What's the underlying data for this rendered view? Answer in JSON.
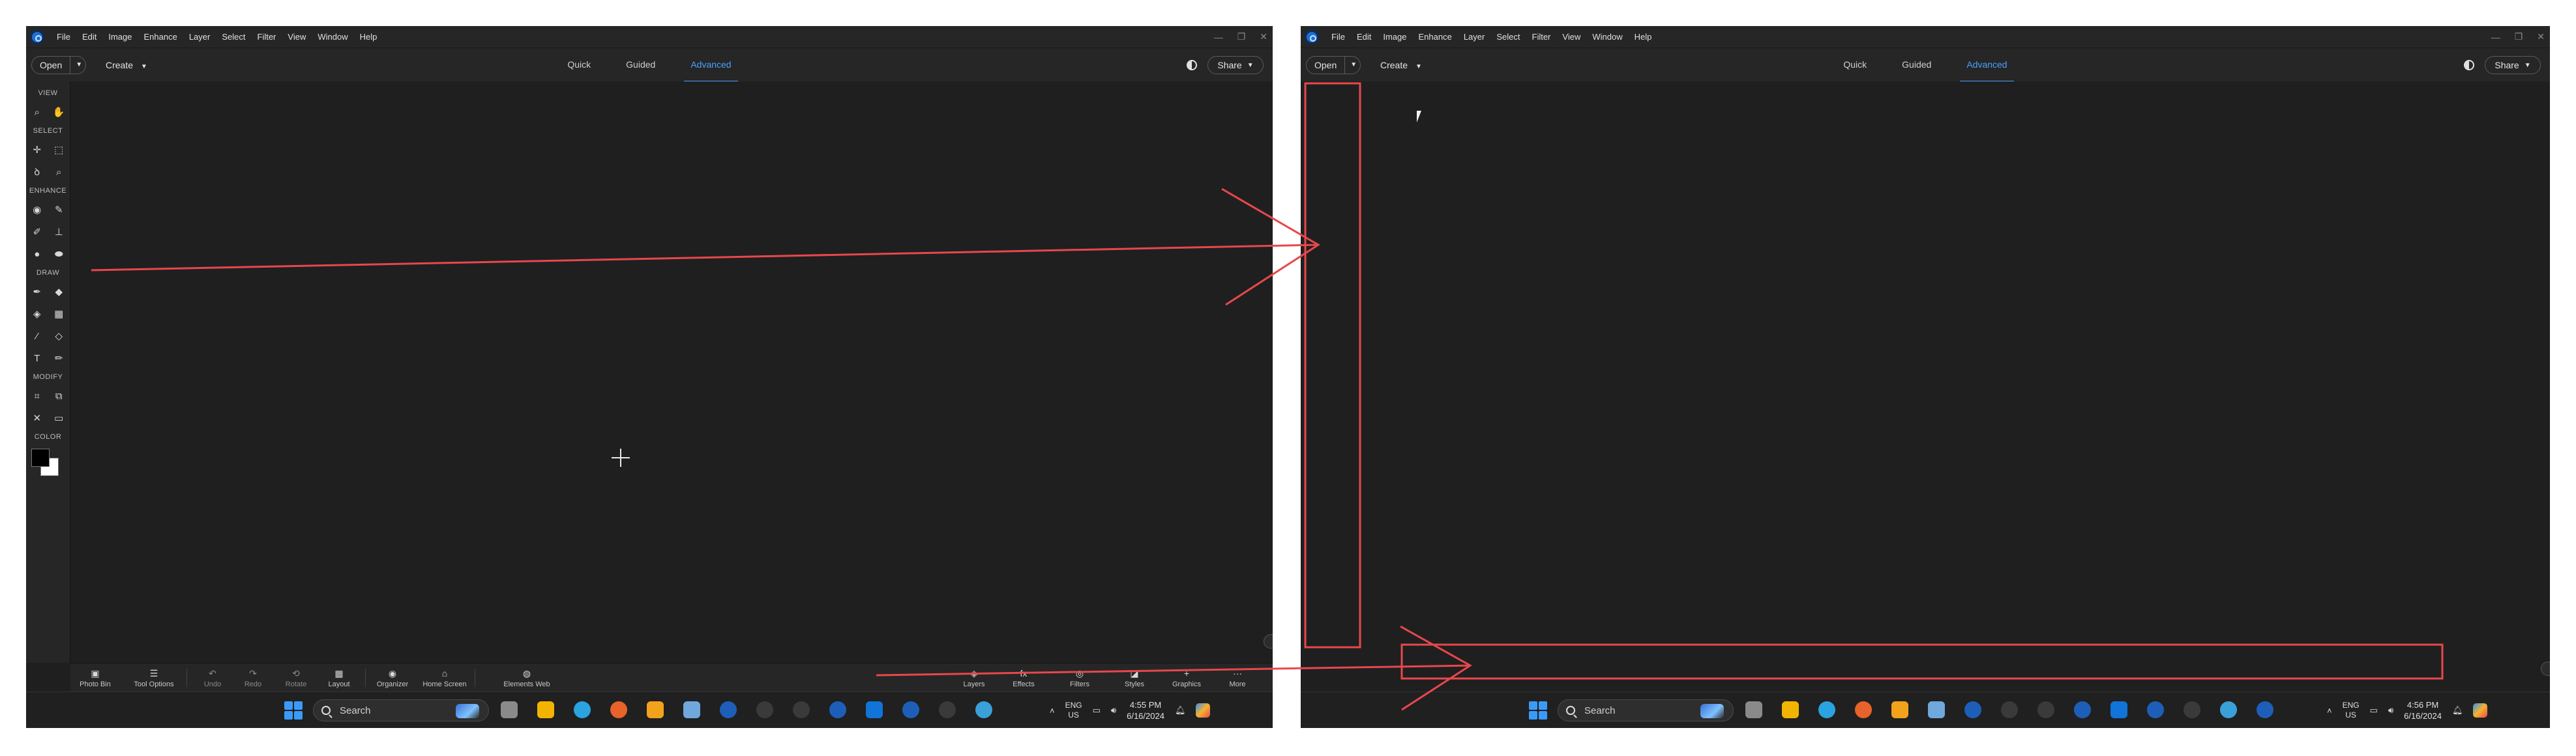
{
  "app": {
    "menu": [
      "File",
      "Edit",
      "Image",
      "Enhance",
      "Layer",
      "Select",
      "Filter",
      "View",
      "Window",
      "Help"
    ],
    "window_controls": [
      "—",
      "❐",
      "✕"
    ]
  },
  "options_bar": {
    "open_label": "Open",
    "create_label": "Create",
    "modes": [
      "Quick",
      "Guided",
      "Advanced"
    ],
    "active_mode": "Advanced",
    "share_label": "Share"
  },
  "toolbox": {
    "sections": [
      "VIEW",
      "SELECT",
      "ENHANCE",
      "DRAW",
      "MODIFY",
      "COLOR"
    ]
  },
  "bottom_bar": {
    "left_items": [
      "Photo Bin",
      "Tool Options",
      "Undo",
      "Redo",
      "Rotate",
      "Layout",
      "Organizer",
      "Home Screen",
      "Elements Web"
    ],
    "right_items": [
      "Layers",
      "Effects",
      "Filters",
      "Styles",
      "Graphics",
      "More"
    ]
  },
  "taskbar": {
    "search_placeholder": "Search",
    "lang_top": "ENG",
    "lang_bottom": "US",
    "left_time": "4:55 PM",
    "right_time": "4:56 PM",
    "date": "6/16/2024"
  },
  "colors": {
    "accent": "#4aa0ff",
    "annotation": "#e8474c",
    "panel": "#262626",
    "canvas": "#1f1f1f"
  }
}
